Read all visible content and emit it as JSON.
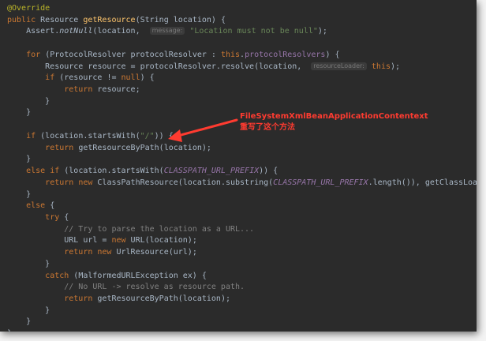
{
  "editor": {
    "lines": [
      [
        {
          "t": "@Override",
          "c": "ann"
        }
      ],
      [
        {
          "t": "public ",
          "c": "kw"
        },
        {
          "t": "Resource "
        },
        {
          "t": "getResource",
          "c": "fn"
        },
        {
          "t": "(String location) {"
        }
      ],
      [
        {
          "t": "    Assert."
        },
        {
          "t": "notNull",
          "c": "static"
        },
        {
          "t": "(location,  "
        },
        {
          "t": "message:",
          "c": "hint"
        },
        {
          "t": " "
        },
        {
          "t": "\"Location must not be null\"",
          "c": "str"
        },
        {
          "t": ");"
        }
      ],
      [],
      [
        {
          "t": "    "
        },
        {
          "t": "for ",
          "c": "kw"
        },
        {
          "t": "(ProtocolResolver protocolResolver : "
        },
        {
          "t": "this",
          "c": "kw"
        },
        {
          "t": "."
        },
        {
          "t": "protocolResolvers",
          "c": "field"
        },
        {
          "t": ") {"
        }
      ],
      [
        {
          "t": "        Resource resource = protocolResolver.resolve(location,  "
        },
        {
          "t": "resourceLoader:",
          "c": "hint"
        },
        {
          "t": " "
        },
        {
          "t": "this",
          "c": "kw"
        },
        {
          "t": ");"
        }
      ],
      [
        {
          "t": "        "
        },
        {
          "t": "if ",
          "c": "kw"
        },
        {
          "t": "(resource != "
        },
        {
          "t": "null",
          "c": "kw"
        },
        {
          "t": ") {"
        }
      ],
      [
        {
          "t": "            "
        },
        {
          "t": "return ",
          "c": "kw"
        },
        {
          "t": "resource;"
        }
      ],
      [
        {
          "t": "        }"
        }
      ],
      [
        {
          "t": "    }"
        }
      ],
      [],
      [
        {
          "t": "    "
        },
        {
          "t": "if ",
          "c": "kw"
        },
        {
          "t": "(location.startsWith("
        },
        {
          "t": "\"/\"",
          "c": "str"
        },
        {
          "t": ")) {"
        }
      ],
      [
        {
          "t": "        "
        },
        {
          "t": "return ",
          "c": "kw"
        },
        {
          "t": "getResourceByPath(location);"
        }
      ],
      [
        {
          "t": "    }"
        }
      ],
      [
        {
          "t": "    "
        },
        {
          "t": "else if ",
          "c": "kw"
        },
        {
          "t": "(location.startsWith("
        },
        {
          "t": "CLASSPATH_URL_PREFIX",
          "c": "const"
        },
        {
          "t": ")) {"
        }
      ],
      [
        {
          "t": "        "
        },
        {
          "t": "return new ",
          "c": "kw"
        },
        {
          "t": "ClassPathResource(location.substring("
        },
        {
          "t": "CLASSPATH_URL_PREFIX",
          "c": "const"
        },
        {
          "t": ".length()), getClassLoader());"
        }
      ],
      [
        {
          "t": "    }"
        }
      ],
      [
        {
          "t": "    "
        },
        {
          "t": "else ",
          "c": "kw"
        },
        {
          "t": "{"
        }
      ],
      [
        {
          "t": "        "
        },
        {
          "t": "try ",
          "c": "kw"
        },
        {
          "t": "{"
        }
      ],
      [
        {
          "t": "            "
        },
        {
          "t": "// Try to parse the location as a URL...",
          "c": "cmt"
        }
      ],
      [
        {
          "t": "            URL url = "
        },
        {
          "t": "new ",
          "c": "kw"
        },
        {
          "t": "URL(location);"
        }
      ],
      [
        {
          "t": "            "
        },
        {
          "t": "return new ",
          "c": "kw"
        },
        {
          "t": "UrlResource(url);"
        }
      ],
      [
        {
          "t": "        }"
        }
      ],
      [
        {
          "t": "        "
        },
        {
          "t": "catch ",
          "c": "kw"
        },
        {
          "t": "(MalformedURLException ex) {"
        }
      ],
      [
        {
          "t": "            "
        },
        {
          "t": "// No URL -> resolve as resource path.",
          "c": "cmt"
        }
      ],
      [
        {
          "t": "            "
        },
        {
          "t": "return ",
          "c": "kw"
        },
        {
          "t": "getResourceByPath(location);"
        }
      ],
      [
        {
          "t": "        }"
        }
      ],
      [
        {
          "t": "    }"
        }
      ],
      [
        {
          "t": "}"
        }
      ]
    ]
  },
  "annotation": {
    "line1": "FileSystemXmlBeanApplicationContentext",
    "line2": "重写了这个方法",
    "color": "#ff3b30"
  },
  "colors": {
    "background": "#2b2b2b",
    "default": "#a9b7c6",
    "keyword": "#cc7832",
    "function": "#ffc66d",
    "string": "#6a8759",
    "field": "#9876aa",
    "comment": "#808080",
    "annotation": "#bbb529"
  }
}
